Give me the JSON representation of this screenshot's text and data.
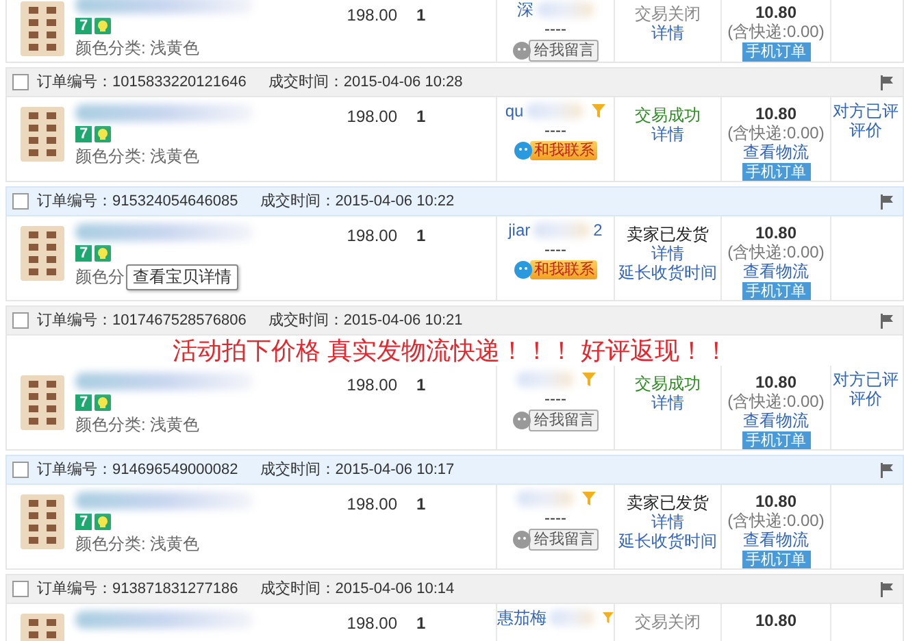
{
  "orders": [
    {
      "product": {
        "badge": "7",
        "color_label": "颜色分类: 浅黄色"
      },
      "price": "198.00",
      "qty": "1",
      "buyer": {
        "name": "深",
        "flag": false,
        "dash": "----",
        "contact": {
          "kind": "offline",
          "label": "给我留言"
        }
      },
      "status": {
        "kind": "closed",
        "text": "交易关闭",
        "links": [
          "详情"
        ]
      },
      "total": {
        "amount": "10.80",
        "shipping": "(含快递:0.00)",
        "mobile": "手机订单"
      }
    },
    {
      "header": {
        "checked": false,
        "highlighted": false,
        "number": "订单编号：1015833220121646",
        "time": "成交时间：2015-04-06 10:28"
      },
      "product": {
        "badge": "7",
        "color_label": "颜色分类: 浅黄色"
      },
      "price": "198.00",
      "qty": "1",
      "buyer": {
        "name": "qu",
        "flag": true,
        "dash": "----",
        "contact": {
          "kind": "online",
          "label": "和我联系"
        }
      },
      "status": {
        "kind": "success",
        "text": "交易成功",
        "links": [
          "详情"
        ]
      },
      "total": {
        "amount": "10.80",
        "shipping": "(含快递:0.00)",
        "links": [
          "查看物流"
        ],
        "mobile": "手机订单"
      },
      "review": [
        "对方已评",
        "评价"
      ]
    },
    {
      "header": {
        "checked": false,
        "highlighted": true,
        "number": "订单编号：915324054646085",
        "time": "成交时间：2015-04-06 10:22"
      },
      "product": {
        "badge": "7",
        "color_label": "颜色分",
        "tooltip": "查看宝贝详情"
      },
      "price": "198.00",
      "qty": "1",
      "buyer": {
        "name": "jiar",
        "suffix": "2",
        "flag": false,
        "dash": "----",
        "contact": {
          "kind": "online",
          "label": "和我联系"
        }
      },
      "status": {
        "kind": "shipped",
        "text": "卖家已发货",
        "links": [
          "详情",
          "延长收货时间"
        ]
      },
      "total": {
        "amount": "10.80",
        "shipping": "(含快递:0.00)",
        "links": [
          "查看物流"
        ],
        "mobile": "手机订单"
      }
    },
    {
      "header": {
        "checked": false,
        "highlighted": false,
        "number": "订单编号：1017467528576806",
        "time": "成交时间：2015-04-06 10:21"
      },
      "banner": "活动拍下价格 真实发物流快递！！！ 好评返现！！",
      "product": {
        "badge": "7",
        "color_label": "颜色分类: 浅黄色"
      },
      "price": "198.00",
      "qty": "1",
      "buyer": {
        "flag": true,
        "dash": "----",
        "contact": {
          "kind": "offline",
          "label": "给我留言"
        }
      },
      "status": {
        "kind": "success",
        "text": "交易成功",
        "links": [
          "详情"
        ]
      },
      "total": {
        "amount": "10.80",
        "shipping": "(含快递:0.00)",
        "links": [
          "查看物流"
        ],
        "mobile": "手机订单"
      },
      "review": [
        "对方已评",
        "评价"
      ]
    },
    {
      "header": {
        "checked": false,
        "highlighted": true,
        "number": "订单编号：914696549000082",
        "time": "成交时间：2015-04-06 10:17"
      },
      "product": {
        "badge": "7",
        "color_label": "颜色分类: 浅黄色"
      },
      "price": "198.00",
      "qty": "1",
      "buyer": {
        "flag": true,
        "dash": "----",
        "contact": {
          "kind": "offline",
          "label": "给我留言"
        }
      },
      "status": {
        "kind": "shipped",
        "text": "卖家已发货",
        "links": [
          "详情",
          "延长收货时间"
        ]
      },
      "total": {
        "amount": "10.80",
        "shipping": "(含快递:0.00)",
        "links": [
          "查看物流"
        ],
        "mobile": "手机订单"
      }
    },
    {
      "header": {
        "checked": false,
        "highlighted": false,
        "number": "订单编号：913871831277186",
        "time": "成交时间：2015-04-06 10:14"
      },
      "price": "198.00",
      "qty": "1",
      "buyer": {
        "name": "惠茄梅",
        "flag": true
      },
      "status": {
        "kind": "closed",
        "text": "交易关闭"
      },
      "total": {
        "amount": "10.80"
      }
    }
  ]
}
